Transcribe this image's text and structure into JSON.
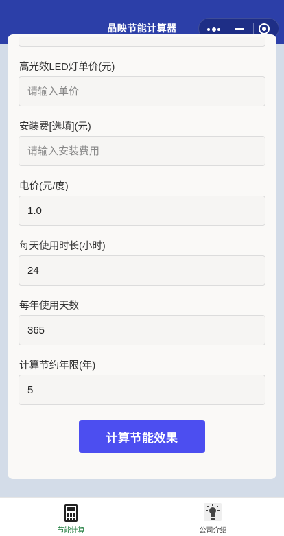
{
  "navbar": {
    "title": "晶映节能计算器"
  },
  "form": {
    "fields": [
      {
        "label": "高光效LED灯单价(元)",
        "placeholder": "请输入单价",
        "value": ""
      },
      {
        "label": "安装费[选填](元)",
        "placeholder": "请输入安装费用",
        "value": ""
      },
      {
        "label": "电价(元/度)",
        "placeholder": "",
        "value": "1.0"
      },
      {
        "label": "每天使用时长(小时)",
        "placeholder": "",
        "value": "24"
      },
      {
        "label": "每年使用天数",
        "placeholder": "",
        "value": "365"
      },
      {
        "label": "计算节约年限(年)",
        "placeholder": "",
        "value": "5"
      }
    ],
    "submit_label": "计算节能效果"
  },
  "tabbar": {
    "tabs": [
      {
        "label": "节能计算",
        "icon": "calculator-icon",
        "active": true
      },
      {
        "label": "公司介绍",
        "icon": "lightbulb-icon",
        "active": false
      }
    ]
  },
  "colors": {
    "navbar": "#2c3fa8",
    "button": "#4c4ef0",
    "active_tab": "#1a7a3a",
    "background": "#d3dce8"
  }
}
